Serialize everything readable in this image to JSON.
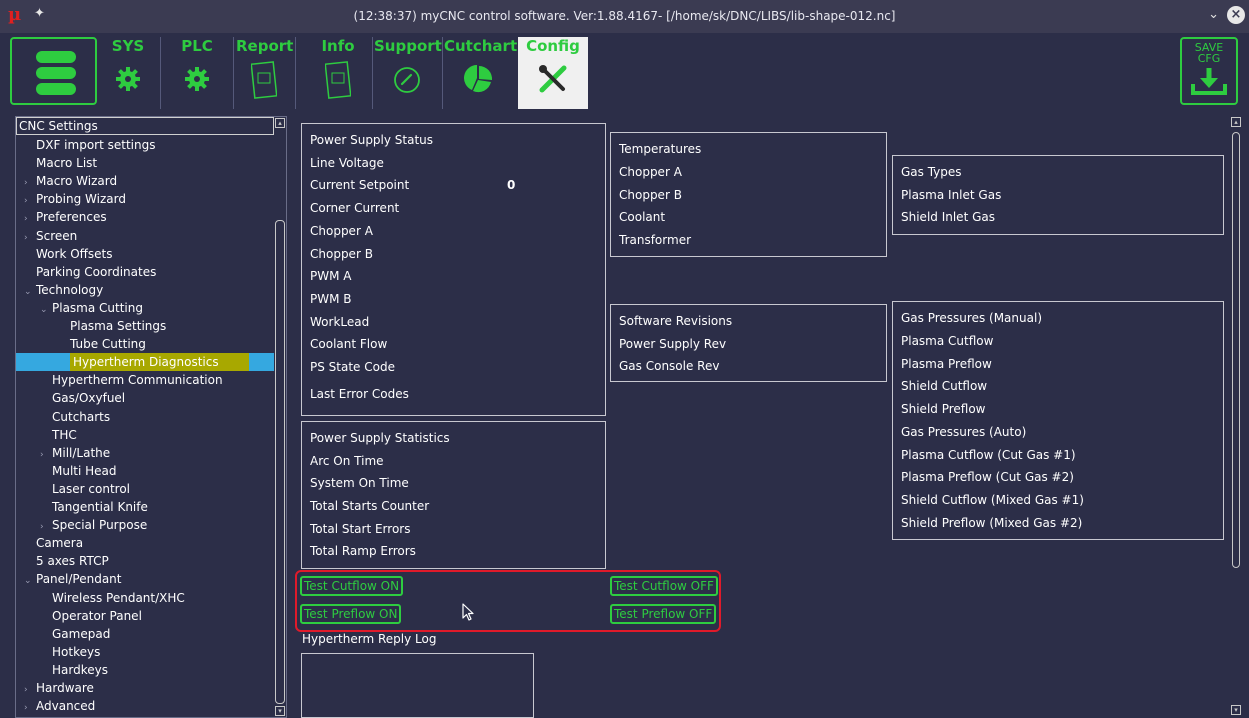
{
  "titlebar": {
    "logo": "µ",
    "title": "(12:38:37) myCNC control software. Ver:1.88.4167- [/home/sk/DNC/LIBS/lib-shape-012.nc]",
    "minimize_glyph": "⌄",
    "close_glyph": "×"
  },
  "toolbar": {
    "tabs": [
      {
        "label": "SYS",
        "icon": "gear-icon"
      },
      {
        "label": "PLC",
        "icon": "gear-icon"
      },
      {
        "label": "Report",
        "icon": "report-icon"
      },
      {
        "label": "Info",
        "icon": "report-icon"
      },
      {
        "label": "Support",
        "icon": "phone-icon"
      },
      {
        "label": "Cutchart",
        "icon": "pie-icon"
      },
      {
        "label": "Config",
        "icon": "tools-icon"
      }
    ],
    "save_label": "SAVE CFG",
    "accent_color": "#2ecc40"
  },
  "sidebar": {
    "header": "CNC Settings",
    "items": [
      {
        "label": "DXF import settings",
        "indent": 1,
        "arrow": false
      },
      {
        "label": "Macro List",
        "indent": 1,
        "arrow": false
      },
      {
        "label": "Macro Wizard",
        "indent": 1,
        "arrow": true
      },
      {
        "label": "Probing Wizard",
        "indent": 1,
        "arrow": true
      },
      {
        "label": "Preferences",
        "indent": 1,
        "arrow": true
      },
      {
        "label": "Screen",
        "indent": 1,
        "arrow": true
      },
      {
        "label": "Work Offsets",
        "indent": 1,
        "arrow": false
      },
      {
        "label": "Parking Coordinates",
        "indent": 1,
        "arrow": false
      },
      {
        "label": "Technology",
        "indent": 1,
        "arrow": true,
        "expanded": true
      },
      {
        "label": "Plasma Cutting",
        "indent": 2,
        "arrow": true,
        "expanded": true
      },
      {
        "label": "Plasma Settings",
        "indent": 3,
        "arrow": false
      },
      {
        "label": "Tube Cutting",
        "indent": 3,
        "arrow": false
      },
      {
        "label": "Hypertherm Diagnostics",
        "indent": 3,
        "arrow": false,
        "selected": true
      },
      {
        "label": "Hypertherm Communication",
        "indent": 2,
        "arrow": false
      },
      {
        "label": "Gas/Oxyfuel",
        "indent": 2,
        "arrow": false
      },
      {
        "label": "Cutcharts",
        "indent": 2,
        "arrow": false
      },
      {
        "label": "THC",
        "indent": 2,
        "arrow": false
      },
      {
        "label": "Mill/Lathe",
        "indent": 2,
        "arrow": true
      },
      {
        "label": "Multi Head",
        "indent": 2,
        "arrow": false
      },
      {
        "label": "Laser control",
        "indent": 2,
        "arrow": false
      },
      {
        "label": "Tangential Knife",
        "indent": 2,
        "arrow": false
      },
      {
        "label": "Special Purpose",
        "indent": 2,
        "arrow": true
      },
      {
        "label": "Camera",
        "indent": 1,
        "arrow": false
      },
      {
        "label": "5 axes RTCP",
        "indent": 1,
        "arrow": false
      },
      {
        "label": "Panel/Pendant",
        "indent": 1,
        "arrow": true,
        "expanded": true
      },
      {
        "label": "Wireless Pendant/XHC",
        "indent": 2,
        "arrow": false
      },
      {
        "label": "Operator Panel",
        "indent": 2,
        "arrow": false
      },
      {
        "label": "Gamepad",
        "indent": 2,
        "arrow": false
      },
      {
        "label": "Hotkeys",
        "indent": 2,
        "arrow": false
      },
      {
        "label": "Hardkeys",
        "indent": 2,
        "arrow": false
      },
      {
        "label": "Hardware",
        "indent": 1,
        "arrow": true
      },
      {
        "label": "Advanced",
        "indent": 1,
        "arrow": true
      }
    ],
    "selection_color": "#a8a800",
    "row_highlight_color": "#35a8e0"
  },
  "power_supply_status": {
    "title": "Power Supply Status",
    "rows": [
      "Line Voltage",
      "Current Setpoint",
      "Corner Current",
      "Chopper A",
      "Chopper B",
      "PWM A",
      "PWM B",
      "WorkLead",
      "Coolant Flow",
      "PS State Code"
    ],
    "current_setpoint_value": "0",
    "last_error": "Last Error Codes"
  },
  "temperatures": {
    "title": "Temperatures",
    "rows": [
      "Chopper A",
      "Chopper B",
      "Coolant",
      "Transformer"
    ]
  },
  "gas_types": {
    "title": "Gas Types",
    "rows": [
      "Plasma Inlet Gas",
      "Shield Inlet Gas"
    ]
  },
  "software_revisions": {
    "title": "Software Revisions",
    "rows": [
      "Power Supply Rev",
      "Gas Console Rev"
    ]
  },
  "gas_pressures": {
    "title": "Gas Pressures (Manual)",
    "rows": [
      "Plasma Cutflow",
      "Plasma Preflow",
      "Shield Cutflow",
      "Shield Preflow",
      "Gas Pressures (Auto)",
      "Plasma Cutflow (Cut Gas #1)",
      "Plasma Preflow (Cut Gas #2)",
      "Shield Cutflow (Mixed Gas #1)",
      "Shield Preflow (Mixed Gas #2)"
    ]
  },
  "power_supply_statistics": {
    "title": "Power Supply Statistics",
    "rows": [
      "Arc On Time",
      "System On Time",
      "Total Starts Counter",
      "Total Start Errors",
      "Total Ramp Errors"
    ]
  },
  "tests": {
    "cutflow_on": "Test Cutflow ON",
    "cutflow_off": "Test Cutflow OFF",
    "preflow_on": "Test Preflow ON",
    "preflow_off": "Test Preflow OFF",
    "highlight_color": "#e01a2a"
  },
  "reply_log": {
    "label": "Hypertherm Reply Log"
  }
}
